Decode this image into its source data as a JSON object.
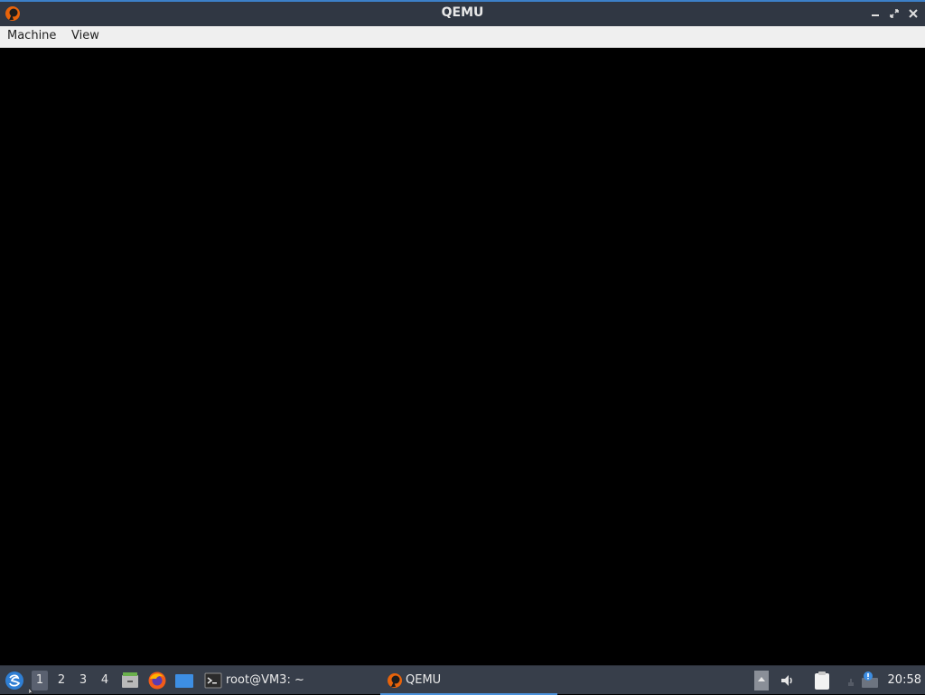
{
  "window": {
    "title": "QEMU",
    "controls": {
      "minimize": "minimize-icon",
      "maximize": "restore-icon",
      "close": "close-icon"
    }
  },
  "menubar": {
    "items": [
      {
        "label": "Machine"
      },
      {
        "label": "View"
      }
    ]
  },
  "taskbar": {
    "workspaces": [
      {
        "label": "1",
        "active": true
      },
      {
        "label": "2",
        "active": false
      },
      {
        "label": "3",
        "active": false
      },
      {
        "label": "4",
        "active": false
      }
    ],
    "launchers": [
      "file-manager-icon",
      "firefox-icon",
      "desktop-icon"
    ],
    "tasks": [
      {
        "label": "root@VM3: ~",
        "icon": "terminal-icon",
        "active": false
      },
      {
        "label": "QEMU",
        "icon": "qemu-icon",
        "active": true
      }
    ],
    "tray": [
      "tray-toggle-icon",
      "volume-icon",
      "clipboard-icon",
      "network-icon",
      "notification-icon"
    ],
    "clock": "20:58"
  },
  "colors": {
    "titlebar": "#303743",
    "accent": "#4a90d9",
    "menubar": "#efefef",
    "screen": "#000000",
    "taskbar": "#373e4a"
  }
}
